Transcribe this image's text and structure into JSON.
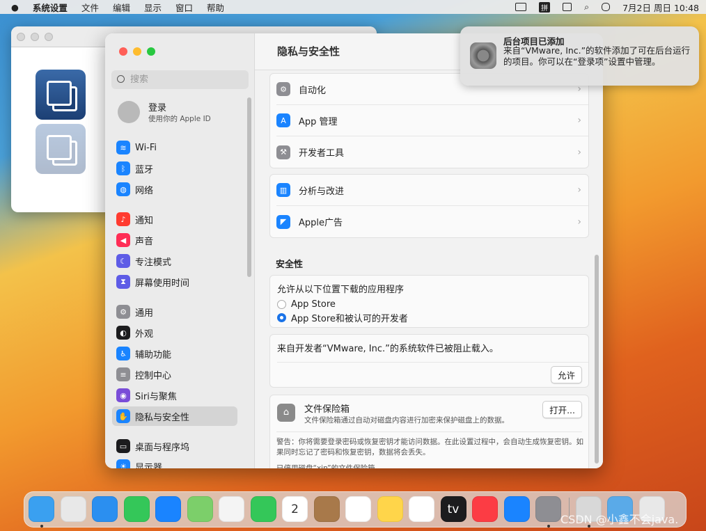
{
  "menubar": {
    "app": "系统设置",
    "items": [
      "文件",
      "编辑",
      "显示",
      "窗口",
      "帮助"
    ],
    "ime": "拼",
    "datetime": "7月2日 周日  10:48"
  },
  "window": {
    "title": "隐私与安全性"
  },
  "sidebar": {
    "search_placeholder": "搜索",
    "login": {
      "title": "登录",
      "subtitle": "使用你的 Apple ID"
    },
    "items": [
      {
        "label": "Wi-Fi",
        "icon": "wifi-icon",
        "color": "#1a84ff"
      },
      {
        "label": "蓝牙",
        "icon": "bluetooth-icon",
        "color": "#1a84ff"
      },
      {
        "label": "网络",
        "icon": "globe-icon",
        "color": "#1a84ff"
      },
      {
        "label": "通知",
        "icon": "bell-icon",
        "color": "#ff3b30"
      },
      {
        "label": "声音",
        "icon": "speaker-icon",
        "color": "#ff2d55"
      },
      {
        "label": "专注模式",
        "icon": "moon-icon",
        "color": "#5e5ce6"
      },
      {
        "label": "屏幕使用时间",
        "icon": "hourglass-icon",
        "color": "#5e5ce6"
      },
      {
        "label": "通用",
        "icon": "gear-icon",
        "color": "#8e8e93"
      },
      {
        "label": "外观",
        "icon": "appearance-icon",
        "color": "#1c1c1e"
      },
      {
        "label": "辅助功能",
        "icon": "accessibility-icon",
        "color": "#1a84ff"
      },
      {
        "label": "控制中心",
        "icon": "switches-icon",
        "color": "#8e8e93"
      },
      {
        "label": "Siri与聚焦",
        "icon": "siri-icon",
        "color": "#7a4dd8"
      },
      {
        "label": "隐私与安全性",
        "icon": "hand-icon",
        "color": "#1a84ff",
        "selected": true
      },
      {
        "label": "桌面与程序坞",
        "icon": "desktop-icon",
        "color": "#1c1c1e"
      },
      {
        "label": "显示器",
        "icon": "sun-icon",
        "color": "#1a84ff"
      }
    ]
  },
  "content": {
    "group1": [
      {
        "label": "自动化",
        "icon": "gear-icon",
        "color": "#8e8e93"
      },
      {
        "label": "App 管理",
        "icon": "app-store-icon",
        "color": "#1a84ff"
      },
      {
        "label": "开发者工具",
        "icon": "hammer-icon",
        "color": "#8e8e93"
      }
    ],
    "group2": [
      {
        "label": "分析与改进",
        "icon": "chart-icon",
        "color": "#1a84ff"
      },
      {
        "label": "Apple广告",
        "icon": "megaphone-icon",
        "color": "#1a84ff"
      }
    ],
    "security_heading": "安全性",
    "allow_label": "允许从以下位置下载的应用程序",
    "radio": [
      {
        "label": "App Store",
        "selected": false
      },
      {
        "label": "App Store和被认可的开发者",
        "selected": true
      }
    ],
    "blocked_text": "来自开发者“VMware, Inc.”的系统软件已被阻止载入。",
    "allow_button": "允许",
    "filevault": {
      "title": "文件保险箱",
      "desc": "文件保险箱通过自动对磁盘内容进行加密来保护磁盘上的数据。",
      "button": "打开...",
      "warning": "警告：你将需要登录密码或恢复密钥才能访问数据。在此设置过程中，会自动生成恢复密钥。如果同时忘记了密码和恢复密钥，数据将会丢失。",
      "status": "已停用磁盘“xin”的文件保险箱。"
    }
  },
  "notification": {
    "title": "后台项目已添加",
    "body": "来自“VMware, Inc.”的软件添加了可在后台运行的项目。你可以在“登录项”设置中管理。"
  },
  "dock": [
    {
      "name": "finder",
      "color": "#3aa0f0",
      "running": true
    },
    {
      "name": "launchpad",
      "color": "#e8e8e8"
    },
    {
      "name": "safari",
      "color": "#2b8ff0"
    },
    {
      "name": "messages",
      "color": "#34c759"
    },
    {
      "name": "mail",
      "color": "#1a84ff"
    },
    {
      "name": "maps",
      "color": "#7ccf6a"
    },
    {
      "name": "photos",
      "color": "#f4f4f4"
    },
    {
      "name": "facetime",
      "color": "#34c759"
    },
    {
      "name": "calendar",
      "color": "#ffffff",
      "label": "2"
    },
    {
      "name": "contacts",
      "color": "#a8794a"
    },
    {
      "name": "reminders",
      "color": "#ffffff"
    },
    {
      "name": "notes",
      "color": "#ffd54a"
    },
    {
      "name": "freeform",
      "color": "#ffffff"
    },
    {
      "name": "tv",
      "color": "#1c1c1e",
      "label": "tv"
    },
    {
      "name": "music",
      "color": "#fc3c44"
    },
    {
      "name": "app-store",
      "color": "#1a84ff"
    },
    {
      "name": "system-settings",
      "color": "#8e8e93",
      "running": true
    },
    {
      "name": "installer",
      "color": "#d8d8d8",
      "running": true
    },
    {
      "name": "downloads",
      "color": "#5aaae8"
    },
    {
      "name": "trash",
      "color": "#e8e8e8"
    }
  ],
  "watermark": "CSDN @小鑫不会java."
}
